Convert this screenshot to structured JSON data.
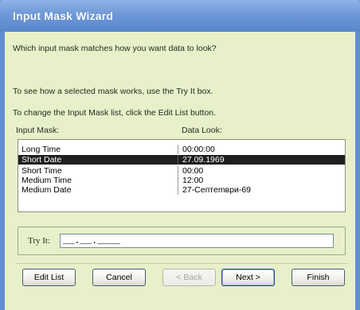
{
  "window": {
    "title": "Input Mask Wizard"
  },
  "prompt": "Which input mask matches how you want data to look?",
  "instructions": {
    "try_it": "To see how a selected mask works, use the Try It box.",
    "edit_list": "To change the Input Mask list, click the Edit List button."
  },
  "list": {
    "columns": [
      "Input Mask:",
      "Data Look:"
    ],
    "rows": [
      {
        "mask": "Long Time",
        "look": "00:00:00"
      },
      {
        "mask": "Short Date",
        "look": "27.09.1969"
      },
      {
        "mask": "Short Time",
        "look": "00:00"
      },
      {
        "mask": "Medium Time",
        "look": "12:00"
      },
      {
        "mask": "Medium Date",
        "look": "27-Септеmври-69"
      }
    ],
    "selected_index": 1
  },
  "try_it": {
    "label": "Try It:",
    "value": "__.__.____"
  },
  "buttons": {
    "edit_list": "Edit List",
    "cancel": "Cancel",
    "back": "< Back",
    "next": "Next >",
    "finish": "Finish"
  },
  "colors": {
    "title_bar": "#6e98d8",
    "client_background": "#e7f0c9",
    "selection": "#1f1f1f"
  }
}
